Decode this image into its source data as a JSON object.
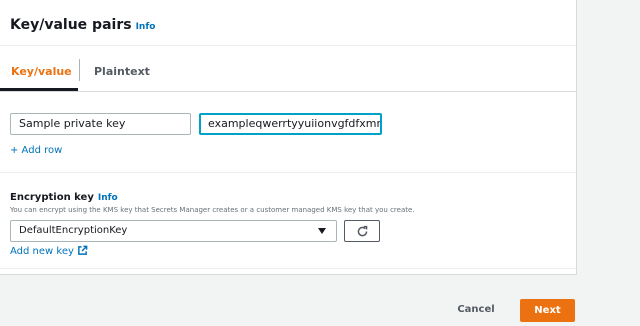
{
  "header": {
    "title": "Key/value pairs",
    "info_label": "Info"
  },
  "tabs": [
    {
      "label": "Key/value",
      "active": true
    },
    {
      "label": "Plaintext",
      "active": false
    }
  ],
  "pair": {
    "key_value": "Sample private key",
    "secret_value": "exampleqwerrtyyuiionvgfdfxmmn"
  },
  "add_row_label": "+ Add row",
  "encryption": {
    "label": "Encryption key",
    "info_label": "Info",
    "description": "You can encrypt using the KMS key that Secrets Manager creates or a customer managed KMS key that you create.",
    "selected": "DefaultEncryptionKey",
    "add_new_key_label": "Add new key"
  },
  "footer": {
    "cancel_label": "Cancel",
    "next_label": "Next"
  },
  "colors": {
    "accent": "#ec7211",
    "link": "#0073bb",
    "focus": "#00a1c9"
  }
}
